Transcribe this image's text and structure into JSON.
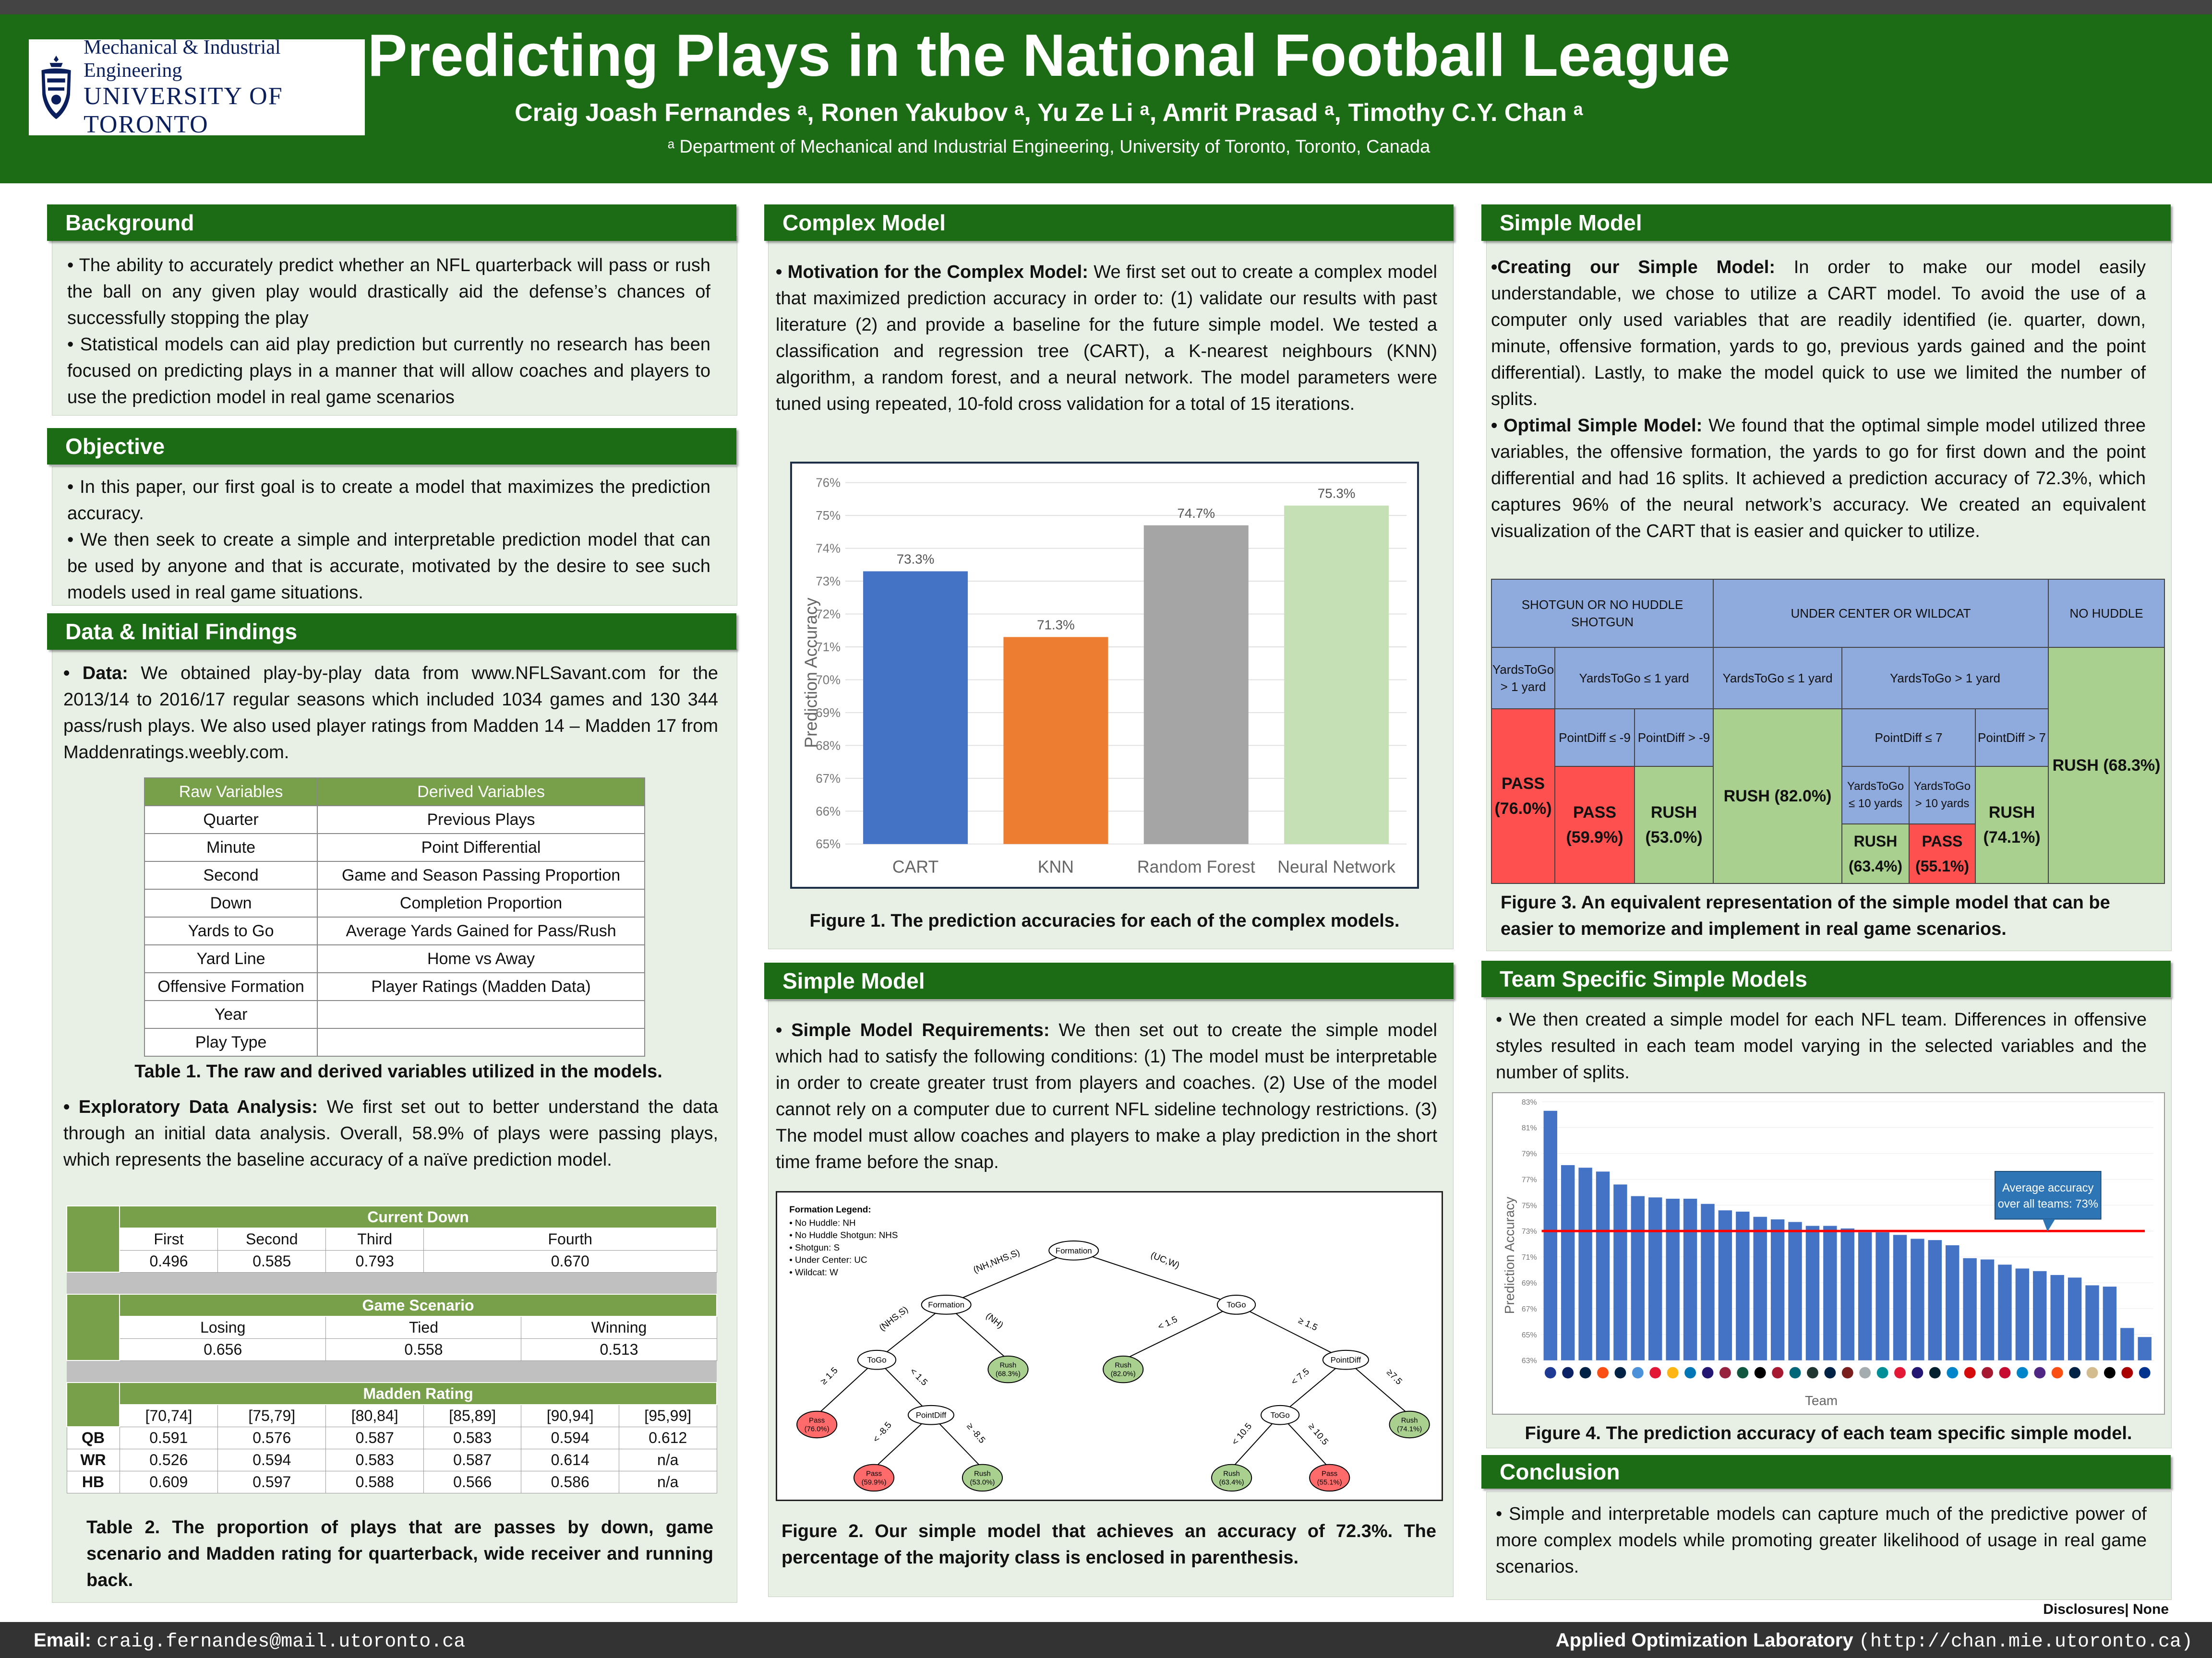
{
  "header": {
    "title": "Predicting Plays in the National Football League",
    "authors": "Craig Joash Fernandes ᵃ, Ronen Yakubov ᵃ, Yu Ze Li ᵃ, Amrit Prasad ᵃ, Timothy C.Y. Chan ᵃ",
    "affiliation": "ᵃ Department of Mechanical and Industrial Engineering, University of Toronto, Toronto, Canada",
    "logo_line1": "Mechanical & Industrial Engineering",
    "logo_line2": "UNIVERSITY OF TORONTO"
  },
  "background": {
    "heading": "Background",
    "b1": "• The ability to accurately predict whether an NFL quarterback will pass or rush the ball on any given play would drastically aid the defense’s chances of successfully stopping the play",
    "b2": "• Statistical models can aid play prediction but currently no research has been focused on predicting plays in a manner that will allow coaches and players to use the prediction model in real game scenarios"
  },
  "objective": {
    "heading": "Objective",
    "b1": "• In this paper, our first goal is to create a model that maximizes the prediction accuracy.",
    "b2": "• We then seek to create a simple and interpretable prediction model that can be used by anyone and that is accurate, motivated by the desire to see such models used in real game situations."
  },
  "data": {
    "heading": "Data & Initial Findings",
    "lead": "• Data:",
    "p1": " We obtained play-by-play data from www.NFLSavant.com for the 2013/14 to 2016/17 regular seasons which included 1034 games and 130 344 pass/rush plays. We also used player ratings from Madden 14 – Madden 17 from Maddenratings.weebly.com.",
    "table1": {
      "headers": [
        "Raw Variables",
        "Derived Variables"
      ],
      "rows": [
        [
          "Quarter",
          "Previous Plays"
        ],
        [
          "Minute",
          "Point Differential"
        ],
        [
          "Second",
          "Game and Season Passing Proportion"
        ],
        [
          "Down",
          "Completion Proportion"
        ],
        [
          "Yards to Go",
          "Average Yards Gained for Pass/Rush"
        ],
        [
          "Yard Line",
          "Home vs Away"
        ],
        [
          "Offensive Formation",
          "Player Ratings (Madden Data)"
        ],
        [
          "Year",
          ""
        ],
        [
          "Play Type",
          ""
        ]
      ]
    },
    "table1_caption": "Table 1. The raw and derived variables utilized in the models.",
    "eda_lead": "• Exploratory Data Analysis:",
    "eda": " We first set out to better understand the data through an initial data analysis. Overall, 58.9% of plays were passing plays, which represents the baseline accuracy of a naïve prediction model.",
    "table2": {
      "down_title": "Current Down",
      "down_cols": [
        "First",
        "Second",
        "Third",
        "Fourth"
      ],
      "down_vals": [
        "0.496",
        "0.585",
        "0.793",
        "0.670"
      ],
      "scen_title": "Game Scenario",
      "scen_cols": [
        "Losing",
        "Tied",
        "Winning"
      ],
      "scen_vals": [
        "0.656",
        "0.558",
        "0.513"
      ],
      "madden_title": "Madden Rating",
      "madden_cols": [
        "[70,74]",
        "[75,79]",
        "[80,84]",
        "[85,89]",
        "[90,94]",
        "[95,99]"
      ],
      "madden_rows": [
        {
          "pos": "QB",
          "vals": [
            "0.591",
            "0.576",
            "0.587",
            "0.583",
            "0.594",
            "0.612"
          ]
        },
        {
          "pos": "WR",
          "vals": [
            "0.526",
            "0.594",
            "0.583",
            "0.587",
            "0.614",
            "n/a"
          ]
        },
        {
          "pos": "HB",
          "vals": [
            "0.609",
            "0.597",
            "0.588",
            "0.566",
            "0.586",
            "n/a"
          ]
        }
      ]
    },
    "table2_caption": "Table 2. The proportion of plays that are passes by down, game scenario and Madden rating for quarterback, wide receiver and running back."
  },
  "complex": {
    "heading": "Complex Model",
    "lead": "• Motivation for the Complex Model:",
    "p1": " We first set out to create a complex model that maximized prediction accuracy in order to: (1) validate our results with past literature (2) and provide a baseline for the future simple model. We tested a classification and regression tree (CART), a K-nearest neighbours (KNN) algorithm, a random forest, and a neural network. The model parameters were tuned using repeated, 10-fold cross validation for a total of 15 iterations.",
    "fig1_caption": "Figure 1. The prediction accuracies for each of the complex models."
  },
  "simple_mid": {
    "heading": "Simple Model",
    "lead": "• Simple Model Requirements:",
    "p1": " We then set out to create the simple model which had to satisfy the following conditions: (1) The model must be interpretable in order to create greater trust from players and coaches. (2) Use of the model cannot rely on a computer due to current NFL sideline technology restrictions. (3) The model must allow coaches and players to make a play prediction in the short time frame before the snap.",
    "fig2_caption": "Figure 2. Our simple model that achieves an accuracy of 72.3%. The percentage of the majority class is enclosed in parenthesis.",
    "tree": {
      "legend_title": "Formation Legend:",
      "legend": [
        "• No Huddle: NH",
        "• No Huddle Shotgun: NHS",
        "• Shotgun: S",
        "• Under Center: UC",
        "• Wildcat: W"
      ],
      "n_formation": "Formation",
      "n_formation2": "Formation",
      "n_togo_l": "ToGo",
      "n_togo_r": "ToGo",
      "n_pd_l": "PointDiff",
      "n_pd_r": "PointDiff",
      "n_togo_rr": "ToGo",
      "e_nhs": "(NH,NHS,S)",
      "e_ucw": "(UC,W)",
      "e_nhs2": "(NHS,S)",
      "e_nh": "(NH)",
      "e_lt15": "< 1.5",
      "e_ge15": "≥ 1.5",
      "e_ge15b": "≥ 1.5",
      "e_lt15b": "< 1.5",
      "e_ltm85": "< -8.5",
      "e_gem85": "≥ -8.5",
      "e_lt75": "< 7.5",
      "e_ge75": "≥7.5",
      "e_lt105": "< 10.5",
      "e_ge105": "≥ 10.5",
      "l_pass76": "Pass",
      "v_pass76": "(76.0%)",
      "l_rush683": "Rush",
      "v_rush683": "(68.3%)",
      "l_rush82": "Rush",
      "v_rush82": "(82.0%)",
      "l_rush741": "Rush",
      "v_rush741": "(74.1%)",
      "l_pass599": "Pass",
      "v_pass599": "(59.9%)",
      "l_rush53": "Rush",
      "v_rush53": "(53.0%)",
      "l_rush634": "Rush",
      "v_rush634": "(63.4%)",
      "l_pass551": "Pass",
      "v_pass551": "(55.1%)"
    }
  },
  "simple_right": {
    "heading": "Simple Model",
    "lead1": "•Creating our Simple Model:",
    "p1": " In order to make our model easily understandable, we chose to utilize a CART model. To avoid the use of a computer only used variables that are readily identified (ie. quarter, down, minute, offensive formation, yards to go, previous yards gained and the point differential). Lastly, to make the model quick to use we limited the number of splits.",
    "lead2": "• Optimal Simple Model:",
    "p2": " We found that the optimal simple model utilized three variables, the offensive formation, the yards to go for first down and the point differential and had 16 splits. It achieved a prediction accuracy of 72.3%, which captures 96% of the neural network’s accuracy. We created an equivalent visualization of the CART that is easier and quicker to utilize.",
    "fig3": {
      "h_shotgun": "SHOTGUN OR NO HUDDLE SHOTGUN",
      "h_uc": "UNDER CENTER OR WILDCAT",
      "h_nh": "NO HUDDLE",
      "s_ytg_gt1": "YardsToGo > 1 yard",
      "s_ytg_le1a": "YardsToGo ≤ 1 yard",
      "s_ytg_le1b": "YardsToGo ≤ 1 yard",
      "s_ytg_gt1b": "YardsToGo > 1 yard",
      "pd_le_m9": "PointDiff ≤ -9",
      "pd_gt_m9": "PointDiff > -9",
      "pd_le7": "PointDiff ≤ 7",
      "pd_gt7": "PointDiff > 7",
      "ytg_le10": "YardsToGo ≤ 10 yards",
      "ytg_gt10": "YardsToGo > 10 yards",
      "pass76": "PASS (76.0%)",
      "pass599": "PASS (59.9%)",
      "rush53": "RUSH (53.0%)",
      "rush82": "RUSH (82.0%)",
      "rush634": "RUSH (63.4%)",
      "pass551": "PASS (55.1%)",
      "rush741": "RUSH (74.1%)",
      "rush683": "RUSH (68.3%)"
    },
    "fig3_caption": "Figure 3. An equivalent representation of the simple model that can be easier to memorize and implement in real game scenarios."
  },
  "team": {
    "heading": "Team Specific Simple Models",
    "p1": "• We then created a simple model for each NFL team. Differences in offensive styles resulted in each team model varying in the selected variables and the number of splits.",
    "fig4_caption": "Figure 4. The prediction accuracy of each team specific simple model.",
    "avg_label_1": "Average accuracy",
    "avg_label_2": "over all teams: 73%"
  },
  "conclusion": {
    "heading": "Conclusion",
    "p1": "• Simple and interpretable models can capture much of the predictive power of more complex models while promoting greater likelihood of usage in real game scenarios."
  },
  "footer": {
    "email_label": "Email:",
    "email": "craig.fernandes@mail.utoronto.ca",
    "lab": "Applied Optimization Laboratory",
    "lab_url": "(http://chan.mie.utoronto.ca)",
    "disclosures": "Disclosures| None"
  },
  "colors": {
    "green": "#1c6b15",
    "panel": "#e8f0e5",
    "cart": "#4472c4",
    "knn": "#ed7d31",
    "rf": "#a5a5a5",
    "nn": "#c5e0b4",
    "team_bar": "#4472c4",
    "avg_line": "#ff0000"
  },
  "chart_data": [
    {
      "type": "bar",
      "categories": [
        "CART",
        "KNN",
        "Random Forest",
        "Neural Network"
      ],
      "values": [
        73.3,
        71.3,
        74.7,
        75.3
      ],
      "value_labels": [
        "73.3%",
        "71.3%",
        "74.7%",
        "75.3%"
      ],
      "ylabel": "Prediction Accuracy",
      "ylim": [
        65,
        76
      ],
      "yticks": [
        "65%",
        "66%",
        "67%",
        "68%",
        "69%",
        "70%",
        "71%",
        "72%",
        "73%",
        "74%",
        "75%",
        "76%"
      ]
    },
    {
      "type": "bar",
      "xlabel": "Team",
      "ylabel": "Prediction Accuracy",
      "ylim": [
        63,
        83
      ],
      "yticks": [
        "63%",
        "65%",
        "67%",
        "69%",
        "71%",
        "73%",
        "75%",
        "77%",
        "79%",
        "81%",
        "83%"
      ],
      "values": [
        82.3,
        78.1,
        77.9,
        77.6,
        76.6,
        75.7,
        75.6,
        75.5,
        75.5,
        75.1,
        74.6,
        74.5,
        74.1,
        73.9,
        73.7,
        73.4,
        73.4,
        73.2,
        72.9,
        72.9,
        72.7,
        72.4,
        72.3,
        71.9,
        70.9,
        70.8,
        70.4,
        70.1,
        69.9,
        69.6,
        69.4,
        68.8,
        68.7,
        65.5,
        64.8
      ],
      "average": 73
    }
  ]
}
